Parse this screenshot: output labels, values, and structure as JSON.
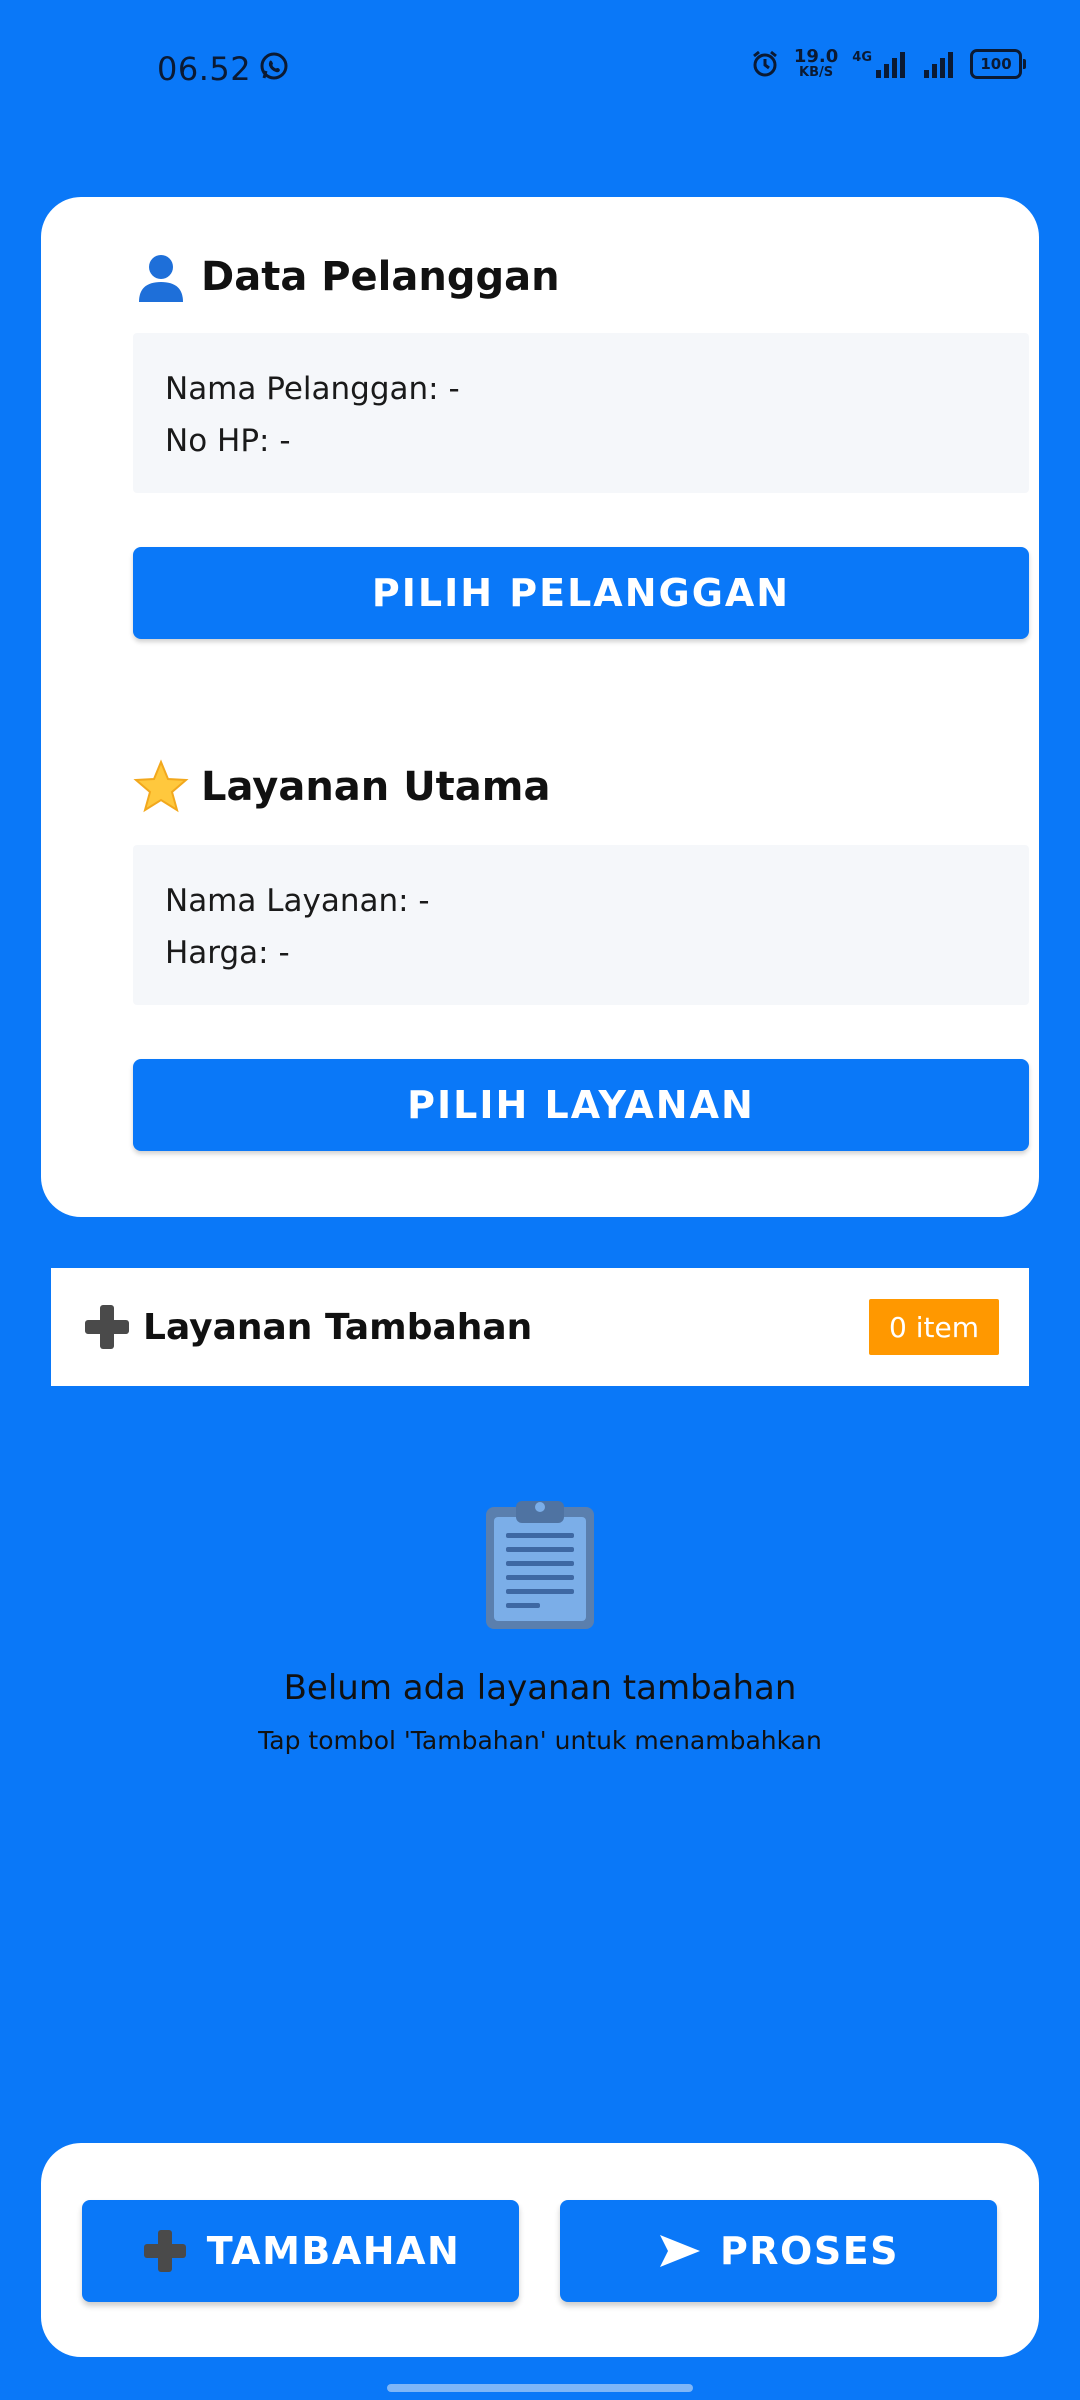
{
  "status_bar": {
    "time": "06.52",
    "speed_value": "19.0",
    "speed_unit": "KB/S",
    "network": "4G",
    "battery": "100"
  },
  "customer": {
    "title": "Data Pelanggan",
    "name_row": "Nama Pelanggan: -",
    "phone_row": "No HP: -",
    "select_button": "PILIH PELANGGAN"
  },
  "main_service": {
    "title": "Layanan Utama",
    "name_row": "Nama Layanan: -",
    "price_row": "Harga: -",
    "select_button": "PILIH LAYANAN"
  },
  "extra_services": {
    "title": "Layanan Tambahan",
    "count_badge": "0 item",
    "empty_title": "Belum ada layanan tambahan",
    "empty_subtitle": "Tap tombol 'Tambahan' untuk menambahkan"
  },
  "actions": {
    "add_label": "TAMBAHAN",
    "process_label": "PROSES"
  },
  "colors": {
    "primary": "#0A78F8",
    "badge": "#FF9800",
    "card": "#FFFFFF",
    "info_box": "#F5F7FA"
  },
  "icons": {
    "customer": "user-icon",
    "main_service": "star-icon",
    "extra_services": "plus-icon",
    "empty_state": "clipboard-icon",
    "process": "send-arrow-icon"
  }
}
